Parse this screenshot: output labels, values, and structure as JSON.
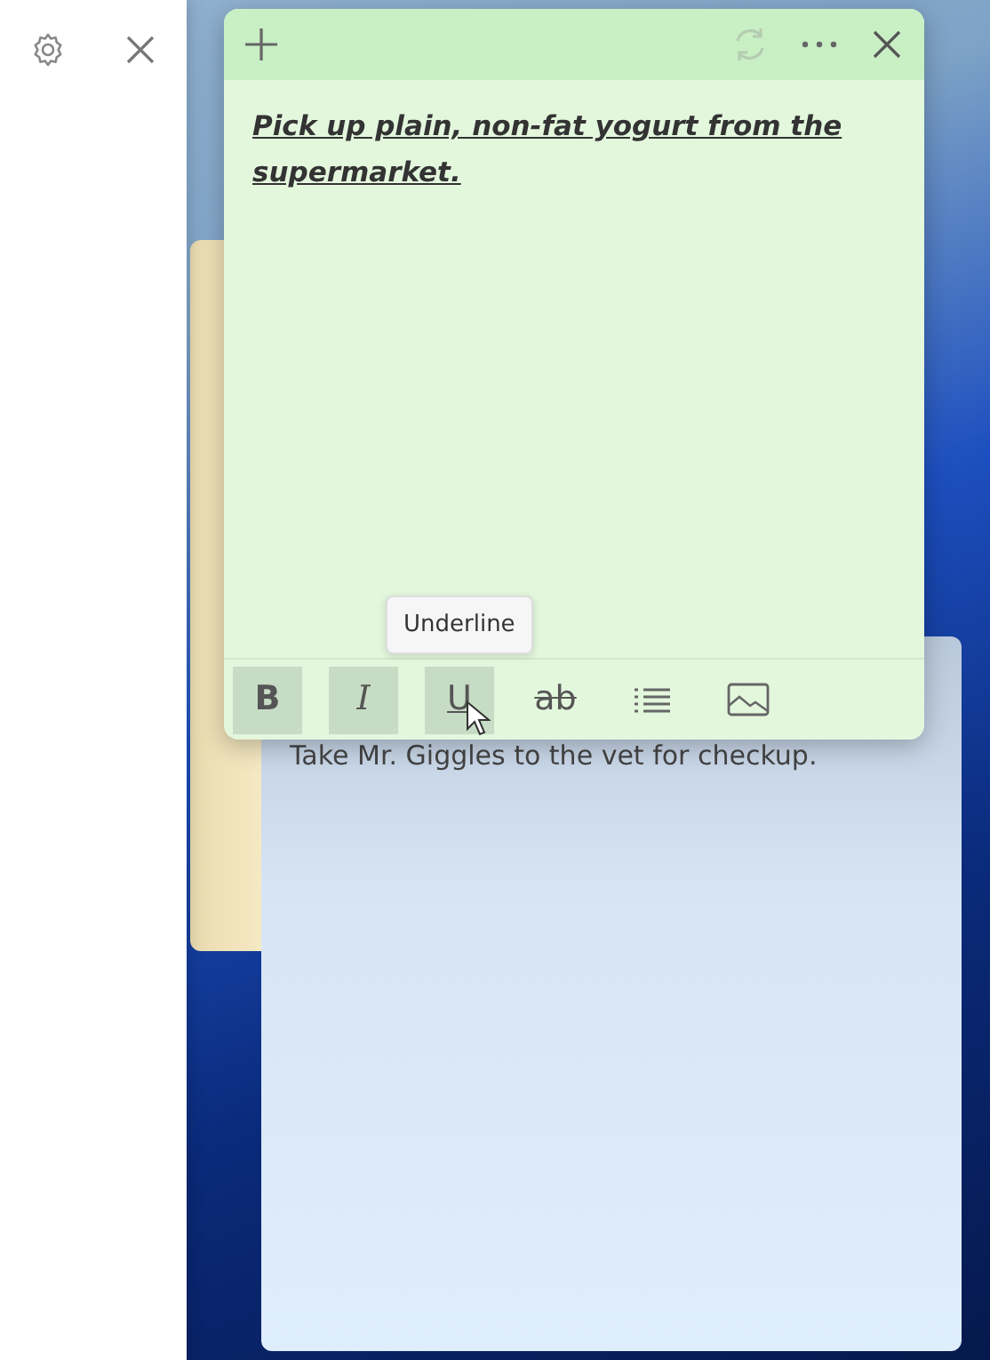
{
  "panel": {
    "buttons": [
      {
        "kind": "settings"
      },
      {
        "kind": "close"
      }
    ]
  },
  "notes_behind": [
    {
      "kind": "yellow"
    },
    {
      "kind": "blue",
      "text": "Take Mr. Giggles to the vet for checkup."
    }
  ],
  "active_note": {
    "text": "Pick up plain, non-fat yogurt from the supermarket.",
    "toolbar": [
      {
        "kind": "text",
        "label": "B",
        "on": true
      },
      {
        "kind": "text",
        "label": "I",
        "on": true
      },
      {
        "kind": "text",
        "label": "U",
        "on": true,
        "tooltip": "Underline"
      },
      {
        "kind": "text",
        "label": "ab",
        "on": false
      },
      {
        "kind": "list",
        "on": false
      },
      {
        "kind": "image",
        "on": false
      }
    ]
  }
}
